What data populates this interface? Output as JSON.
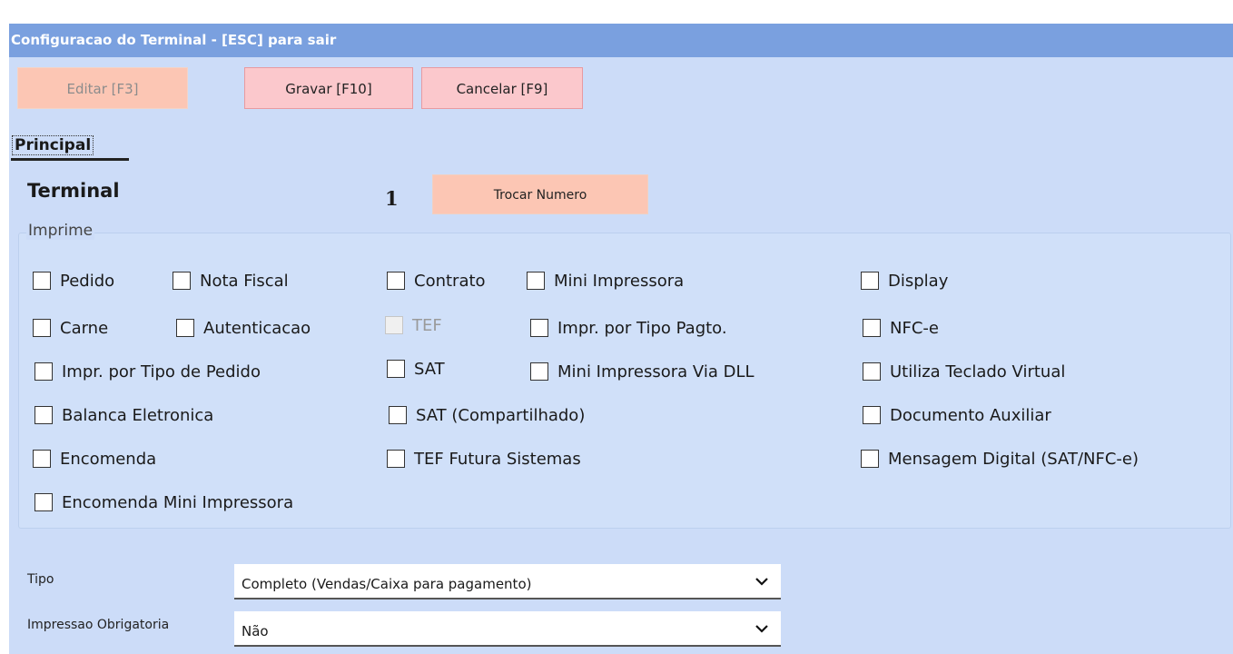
{
  "window": {
    "title": "Configuracao do Terminal - [ESC] para sair"
  },
  "toolbar": {
    "edit_label": "Editar [F3]",
    "save_label": "Gravar [F10]",
    "cancel_label": "Cancelar [F9]"
  },
  "tabs": [
    {
      "label": "Principal",
      "active": true
    }
  ],
  "terminal": {
    "label": "Terminal",
    "number": "1",
    "change_number_label": "Trocar Numero"
  },
  "imprime": {
    "title": "Imprime",
    "options": [
      {
        "label": "Pedido",
        "checked": false,
        "enabled": true
      },
      {
        "label": "Nota Fiscal",
        "checked": false,
        "enabled": true
      },
      {
        "label": "Contrato",
        "checked": false,
        "enabled": true
      },
      {
        "label": "Mini Impressora",
        "checked": false,
        "enabled": true
      },
      {
        "label": "Display",
        "checked": false,
        "enabled": true
      },
      {
        "label": "Carne",
        "checked": false,
        "enabled": true
      },
      {
        "label": "Autenticacao",
        "checked": false,
        "enabled": true
      },
      {
        "label": "TEF",
        "checked": false,
        "enabled": false
      },
      {
        "label": "Impr. por Tipo Pagto.",
        "checked": false,
        "enabled": true
      },
      {
        "label": "NFC-e",
        "checked": false,
        "enabled": true
      },
      {
        "label": "Impr. por Tipo de Pedido",
        "checked": false,
        "enabled": true
      },
      {
        "label": "SAT",
        "checked": false,
        "enabled": true
      },
      {
        "label": "Mini Impressora Via DLL",
        "checked": false,
        "enabled": true
      },
      {
        "label": "Utiliza Teclado Virtual",
        "checked": false,
        "enabled": true
      },
      {
        "label": "Balanca Eletronica",
        "checked": false,
        "enabled": true
      },
      {
        "label": "SAT (Compartilhado)",
        "checked": false,
        "enabled": true
      },
      {
        "label": "Documento Auxiliar",
        "checked": false,
        "enabled": true
      },
      {
        "label": "Encomenda",
        "checked": false,
        "enabled": true
      },
      {
        "label": "TEF Futura Sistemas",
        "checked": false,
        "enabled": true
      },
      {
        "label": "Mensagem Digital (SAT/NFC-e)",
        "checked": false,
        "enabled": true
      },
      {
        "label": "Encomenda Mini Impressora",
        "checked": false,
        "enabled": true
      }
    ]
  },
  "fields": {
    "tipo": {
      "label": "Tipo",
      "value": "Completo (Vendas/Caixa para pagamento)"
    },
    "impressao": {
      "label": "Impressao Obrigatoria",
      "value": "Não"
    }
  },
  "icons": {
    "dropdown": "chevron-down-icon"
  },
  "colors": {
    "titlebar": "#7aa0df",
    "background": "#ccdcf8",
    "button_edit": "#fcc6b4",
    "button_action": "#fbc8cc"
  }
}
